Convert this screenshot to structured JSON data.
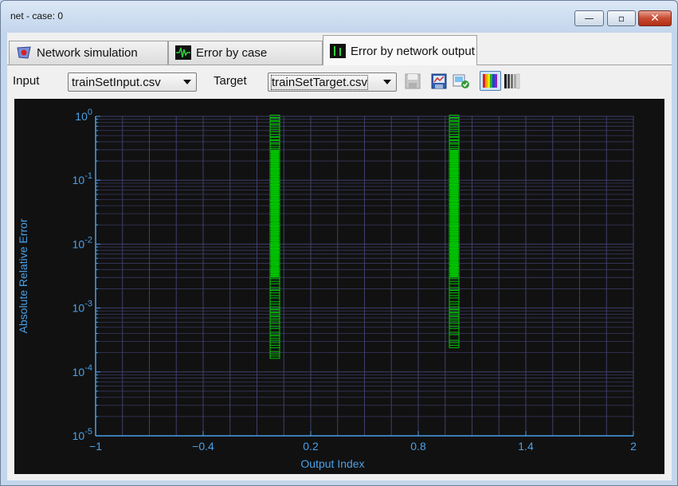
{
  "window": {
    "title": "net - case: 0",
    "min_glyph": "—",
    "max_glyph": "▫",
    "close_glyph": "✕"
  },
  "tabs": [
    {
      "label": "Network simulation",
      "icon": "network-icon",
      "active": false
    },
    {
      "label": "Error by case",
      "icon": "waveform-icon",
      "active": false
    },
    {
      "label": "Error by network output",
      "icon": "bar-icon",
      "active": true
    }
  ],
  "toolbar": {
    "input_label": "Input",
    "input_value": "trainSetInput.csv",
    "target_label": "Target",
    "target_value": "trainSetTarget.csv",
    "buttons": [
      "save-icon",
      "save-image-icon",
      "export-image-icon",
      "color-palette-icon",
      "grayscale-palette-icon"
    ]
  },
  "colors": {
    "plot_bg": "#111111",
    "grid": "#3f3f6e",
    "axis_text": "#4aa0e6",
    "series": "#00c800"
  },
  "chart_data": {
    "type": "scatter",
    "xlabel": "Output Index",
    "ylabel": "Absolute Relative Error",
    "xlim": [
      -1,
      2
    ],
    "ylim": [
      1e-05,
      1
    ],
    "yscale": "log",
    "grid": true,
    "xticks": [
      "−1",
      "−0.4",
      "0.2",
      "0.8",
      "1.4",
      "2"
    ],
    "xtick_values": [
      -1,
      -0.4,
      0.2,
      0.8,
      1.4,
      2
    ],
    "yticks": [
      {
        "base": "10",
        "exp": "0",
        "value": 1
      },
      {
        "base": "10",
        "exp": "-1",
        "value": 0.1
      },
      {
        "base": "10",
        "exp": "-2",
        "value": 0.01
      },
      {
        "base": "10",
        "exp": "-3",
        "value": 0.001
      },
      {
        "base": "10",
        "exp": "-4",
        "value": 0.0001
      },
      {
        "base": "10",
        "exp": "-5",
        "value": 1e-05
      }
    ],
    "series": [
      {
        "x": 0,
        "y": [
          1.0,
          0.9,
          0.8,
          0.7,
          0.6,
          0.5,
          0.45,
          0.4,
          0.35,
          0.3,
          0.26,
          0.22,
          0.19,
          0.16,
          0.14,
          0.12,
          0.1,
          0.09,
          0.08,
          0.07,
          0.06,
          0.05,
          0.045,
          0.04,
          0.035,
          0.03,
          0.025,
          0.02,
          0.018,
          0.015,
          0.012,
          0.01,
          0.009,
          0.008,
          0.007,
          0.006,
          0.005,
          0.004,
          0.0035,
          0.003,
          0.0025,
          0.002,
          0.0018,
          0.0015,
          0.0012,
          0.001,
          0.0009,
          0.0008,
          0.0007,
          0.0006,
          0.0005,
          0.0004,
          0.00035,
          0.0003,
          0.00025,
          0.0002,
          0.00017
        ]
      },
      {
        "x": 1,
        "y": [
          1.0,
          0.9,
          0.8,
          0.7,
          0.6,
          0.5,
          0.45,
          0.4,
          0.35,
          0.3,
          0.26,
          0.22,
          0.19,
          0.16,
          0.14,
          0.12,
          0.1,
          0.09,
          0.08,
          0.07,
          0.06,
          0.05,
          0.045,
          0.04,
          0.035,
          0.03,
          0.025,
          0.02,
          0.018,
          0.015,
          0.012,
          0.01,
          0.009,
          0.008,
          0.007,
          0.006,
          0.005,
          0.0045,
          0.004,
          0.0035,
          0.003,
          0.0025,
          0.002,
          0.0018,
          0.0015,
          0.0012,
          0.001,
          0.0009,
          0.0008,
          0.0007,
          0.0006,
          0.0005,
          0.0004,
          0.0003,
          0.00025
        ]
      }
    ]
  }
}
